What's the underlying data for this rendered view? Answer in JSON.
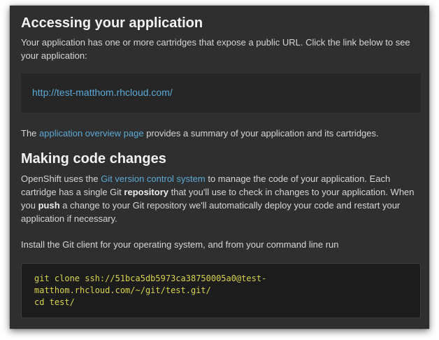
{
  "section1": {
    "heading": "Accessing your application",
    "intro": "Your application has one or more cartridges that expose a public URL. Click the link below to see your application:",
    "app_url": "http://test-matthom.rhcloud.com/",
    "overview_prefix": "The ",
    "overview_link": "application overview page",
    "overview_suffix": " provides a summary of your application and its cartridges."
  },
  "section2": {
    "heading": "Making code changes",
    "git_prefix": "OpenShift uses the ",
    "git_link": "Git version control system",
    "git_mid1": " to manage the code of your application. Each cartridge has a single Git ",
    "git_bold1": "repository",
    "git_mid2": " that you'll use to check in changes to your application. When you ",
    "git_bold2": "push",
    "git_suffix": " a change to your Git repository we'll automatically deploy your code and restart your application if necessary.",
    "install_text": "Install the Git client for your operating system, and from your command line run",
    "code_lines": [
      "git clone ssh://51bca5db5973ca38750005a0@test-",
      "matthom.rhcloud.com/~/git/test.git/",
      "cd test/"
    ]
  },
  "colors": {
    "panel_bg": "#2f2f2f",
    "link": "#5ba9d6",
    "code_text": "#d8d44a",
    "heading": "#f2f2f2"
  }
}
